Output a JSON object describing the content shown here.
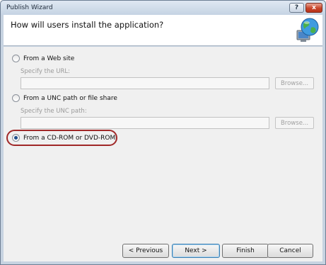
{
  "window": {
    "title": "Publish Wizard",
    "help_glyph": "?",
    "close_glyph": "x"
  },
  "header": {
    "title": "How will users install the application?",
    "icon": "globe-computer-icon"
  },
  "options": {
    "web": {
      "label": "From a Web site",
      "selected": false,
      "sub_label": "Specify the URL:",
      "value": "",
      "browse_label": "Browse..."
    },
    "unc": {
      "label": "From a UNC path or file share",
      "selected": false,
      "sub_label": "Specify the UNC path:",
      "value": "",
      "browse_label": "Browse..."
    },
    "cd": {
      "label": "From a CD-ROM or DVD-ROM",
      "selected": true
    }
  },
  "buttons": {
    "previous": "< Previous",
    "next": "Next >",
    "finish": "Finish",
    "cancel": "Cancel"
  },
  "colors": {
    "highlight_ring": "#a02828",
    "selected_radio": "#1f4e8c"
  }
}
